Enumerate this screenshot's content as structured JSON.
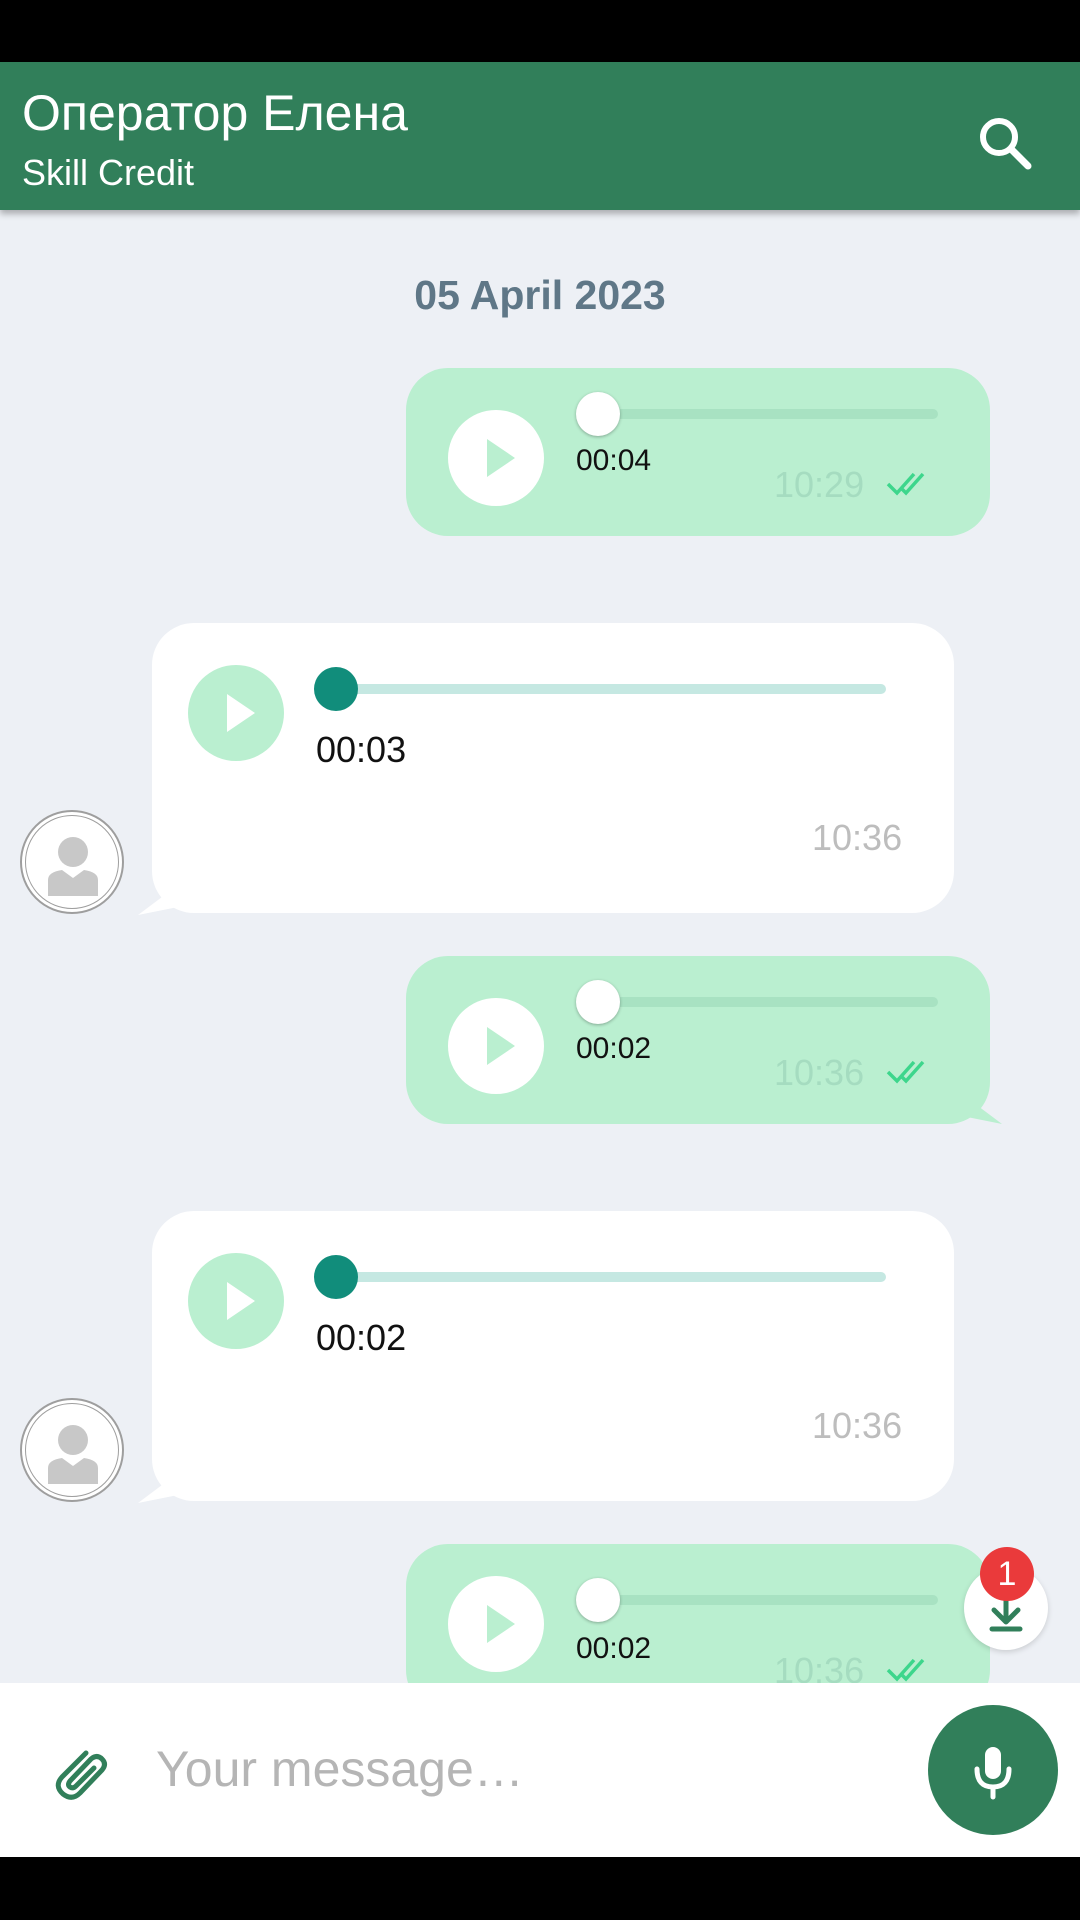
{
  "header": {
    "title": "Оператор Елена",
    "subtitle": "Skill Credit",
    "search_icon": "search-icon"
  },
  "chat": {
    "date_label": "05 April 2023",
    "messages": [
      {
        "direction": "outgoing",
        "duration": "00:04",
        "time": "10:29",
        "status": "read",
        "progress": 0
      },
      {
        "direction": "incoming",
        "duration": "00:03",
        "time": "10:36",
        "progress": 0
      },
      {
        "direction": "outgoing",
        "duration": "00:02",
        "time": "10:36",
        "status": "read",
        "progress": 0
      },
      {
        "direction": "incoming",
        "duration": "00:02",
        "time": "10:36",
        "progress": 0
      },
      {
        "direction": "outgoing",
        "duration": "00:02",
        "time": "10:36",
        "status": "read",
        "progress": 0
      }
    ]
  },
  "scroll_down": {
    "unread_count": "1",
    "icon": "arrow-down-icon"
  },
  "composer": {
    "placeholder": "Your message…",
    "attach_icon": "paperclip-icon",
    "mic_icon": "microphone-icon"
  },
  "colors": {
    "header": "#317f5a",
    "outgoing_bubble": "#baefd0",
    "incoming_bubble": "#ffffff",
    "chat_background": "#edf0f5",
    "accent_teal": "#118d7b",
    "badge": "#ea3a3b"
  }
}
